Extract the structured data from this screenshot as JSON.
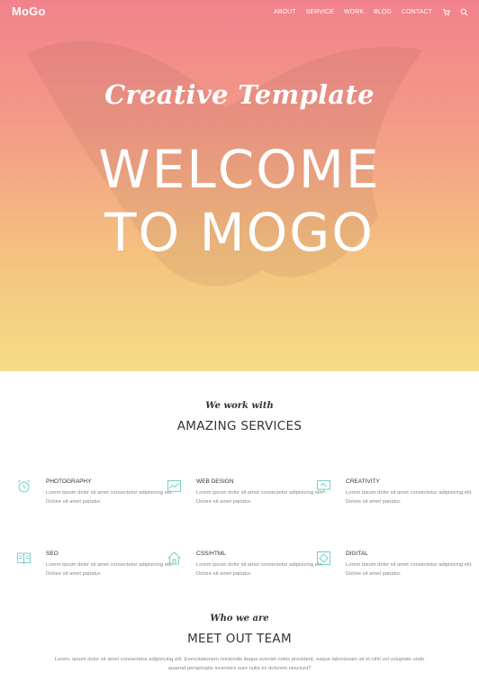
{
  "header": {
    "logo": "MoGo",
    "nav": [
      "ABOUT",
      "SERVICE",
      "WORK",
      "BLOG",
      "CONTACT"
    ],
    "icons": [
      "cart-icon",
      "search-icon"
    ]
  },
  "hero": {
    "subtitle": "Creative Template",
    "title_line1": "WELCOME",
    "title_line2": "TO MOGO"
  },
  "services": {
    "subtitle": "We work with",
    "title": "AMAZING SERVICES",
    "items": [
      {
        "title": "PHOTOGRAPHY",
        "icon": "alarm-clock-icon",
        "text": "Lorem ipsum dolor sit amet consectetur adipisicing elit. Dolore sit amet pariatur."
      },
      {
        "title": "WEB DESIGN",
        "icon": "chart-icon",
        "text": "Lorem ipsum dolor sit amet consectetur adipisicing elit. Dolore sit amet pariatur."
      },
      {
        "title": "CREATIVITY",
        "icon": "monitor-icon",
        "text": "Lorem ipsum dolor sit amet consectetur adipisicing elit. Dolore sit amet pariatur."
      },
      {
        "title": "SEO",
        "icon": "book-icon",
        "text": "Lorem ipsum dolor sit amet consectetur adipisicing elit. Dolore sit amet pariatur."
      },
      {
        "title": "CSS/HTML",
        "icon": "house-icon",
        "text": "Lorem ipsum dolor sit amet consectetur adipisicing elit. Dolore sit amet pariatur."
      },
      {
        "title": "DIGITAL",
        "icon": "frame-icon",
        "text": "Lorem ipsum dolor sit amet consectetur adipisicing elit. Dolore sit amet pariatur."
      }
    ]
  },
  "team": {
    "subtitle": "Who we are",
    "title": "MEET OUT TEAM",
    "text": "Lorem, ipsum dolor sit amet consectetur adipisicing elit. Exercitationem reiciendis itaque eveniet nobis provident, eaque laboriosam sit et nihil vel voluptate unde quaerat perspiciatis inventore sunt nulla ex dolorem nesciunt?"
  },
  "colors": {
    "accent": "#7fd1c8",
    "hero_top": "#f1828c",
    "hero_bottom": "#f5dd86"
  }
}
